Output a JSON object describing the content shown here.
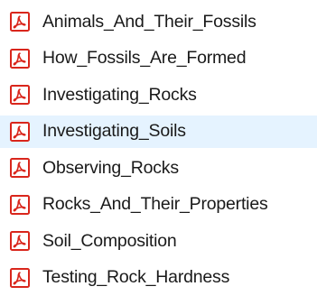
{
  "files": [
    {
      "name": "Animals_And_Their_Fossils",
      "icon": "pdf-file-icon",
      "hovered": false
    },
    {
      "name": "How_Fossils_Are_Formed",
      "icon": "pdf-file-icon",
      "hovered": false
    },
    {
      "name": "Investigating_Rocks",
      "icon": "pdf-file-icon",
      "hovered": false
    },
    {
      "name": "Investigating_Soils",
      "icon": "pdf-file-icon",
      "hovered": true
    },
    {
      "name": "Observing_Rocks",
      "icon": "pdf-file-icon",
      "hovered": false
    },
    {
      "name": "Rocks_And_Their_Properties",
      "icon": "pdf-file-icon",
      "hovered": false
    },
    {
      "name": "Soil_Composition",
      "icon": "pdf-file-icon",
      "hovered": false
    },
    {
      "name": "Testing_Rock_Hardness",
      "icon": "pdf-file-icon",
      "hovered": false
    }
  ],
  "colors": {
    "icon_red": "#d9261c",
    "hover_background": "#e5f3ff",
    "text": "#1a1a1a"
  }
}
